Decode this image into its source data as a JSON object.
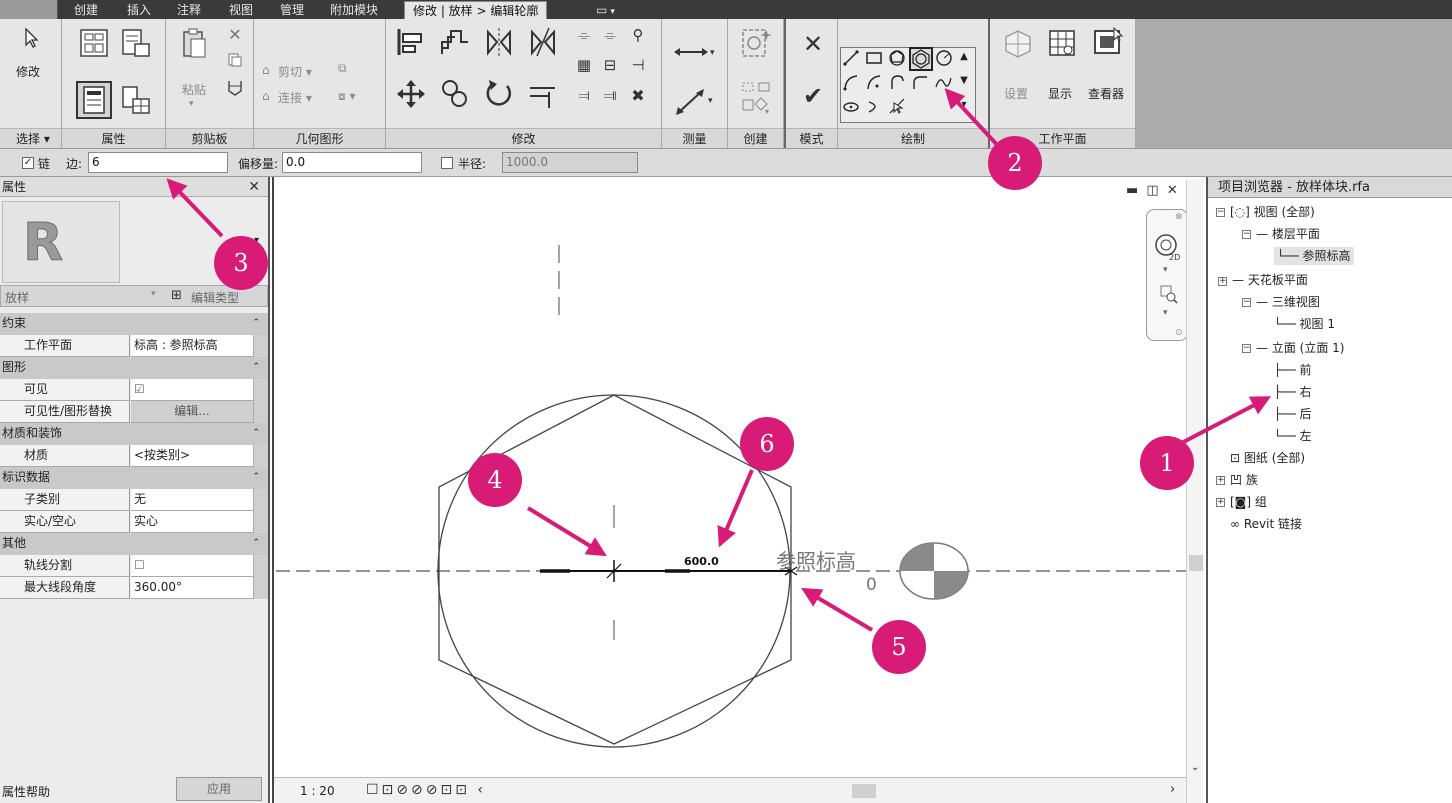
{
  "tabs": {
    "items": [
      "创建",
      "插入",
      "注释",
      "视图",
      "管理",
      "附加模块"
    ],
    "active": "修改 | 放样 > 编辑轮廓"
  },
  "ribbon": {
    "select_label": "修改",
    "select_panel": "选择 ▾",
    "properties_panel": "属性",
    "clipboard_paste": "粘贴",
    "clipboard_panel": "剪贴板",
    "geometry_cut": "剪切 ▾",
    "geometry_join": "连接 ▾",
    "geometry_panel": "几何图形",
    "modify_panel": "修改",
    "measure_panel": "测量",
    "create_panel": "创建",
    "mode_panel": "模式",
    "draw_panel": "绘制",
    "workplane_set": "设置",
    "workplane_show": "显示",
    "workplane_viewer": "查看器",
    "workplane_panel": "工作平面"
  },
  "options": {
    "chain_label": "链",
    "sides_label": "边:",
    "sides_value": "6",
    "offset_label": "偏移量:",
    "offset_value": "0.0",
    "radius_label": "半径:",
    "radius_value": "1000.0"
  },
  "properties": {
    "title": "属性",
    "type_name": "放样",
    "edit_type": "编辑类型",
    "rows": [
      {
        "cat": "约束"
      },
      {
        "k": "工作平面",
        "v": "标高 : 参照标高"
      },
      {
        "cat": "图形"
      },
      {
        "k": "可见",
        "v": "☑"
      },
      {
        "k": "可见性/图形替换",
        "v": "编辑..."
      },
      {
        "cat": "材质和装饰"
      },
      {
        "k": "材质",
        "v": "<按类别>"
      },
      {
        "cat": "标识数据"
      },
      {
        "k": "子类别",
        "v": "无"
      },
      {
        "k": "实心/空心",
        "v": "实心"
      },
      {
        "cat": "其他"
      },
      {
        "k": "轨线分割",
        "v": "☐"
      },
      {
        "k": "最大线段角度",
        "v": "360.00°"
      }
    ],
    "help": "属性帮助",
    "apply": "应用"
  },
  "canvas": {
    "dimension": "600.0",
    "level_name": "参照标高",
    "level_value": "0",
    "scale": "1 : 20"
  },
  "browser": {
    "title": "项目浏览器 - 放样体块.rfa",
    "nodes": [
      {
        "label": "视图 (全部)"
      },
      {
        "label": "楼层平面"
      },
      {
        "label": "参照标高"
      },
      {
        "label": "天花板平面"
      },
      {
        "label": "三维视图"
      },
      {
        "label": "视图 1"
      },
      {
        "label": "立面 (立面 1)"
      },
      {
        "label": "前"
      },
      {
        "label": "右"
      },
      {
        "label": "后"
      },
      {
        "label": "左"
      },
      {
        "label": "图纸 (全部)"
      },
      {
        "label": "族"
      },
      {
        "label": "组"
      },
      {
        "label": "Revit 链接"
      }
    ]
  },
  "callouts": [
    "1",
    "2",
    "3",
    "4",
    "5",
    "6"
  ],
  "colors": {
    "callout": "#d81b76",
    "ribbon": "#e6e6e6",
    "tabbar": "#3a3a3a"
  }
}
